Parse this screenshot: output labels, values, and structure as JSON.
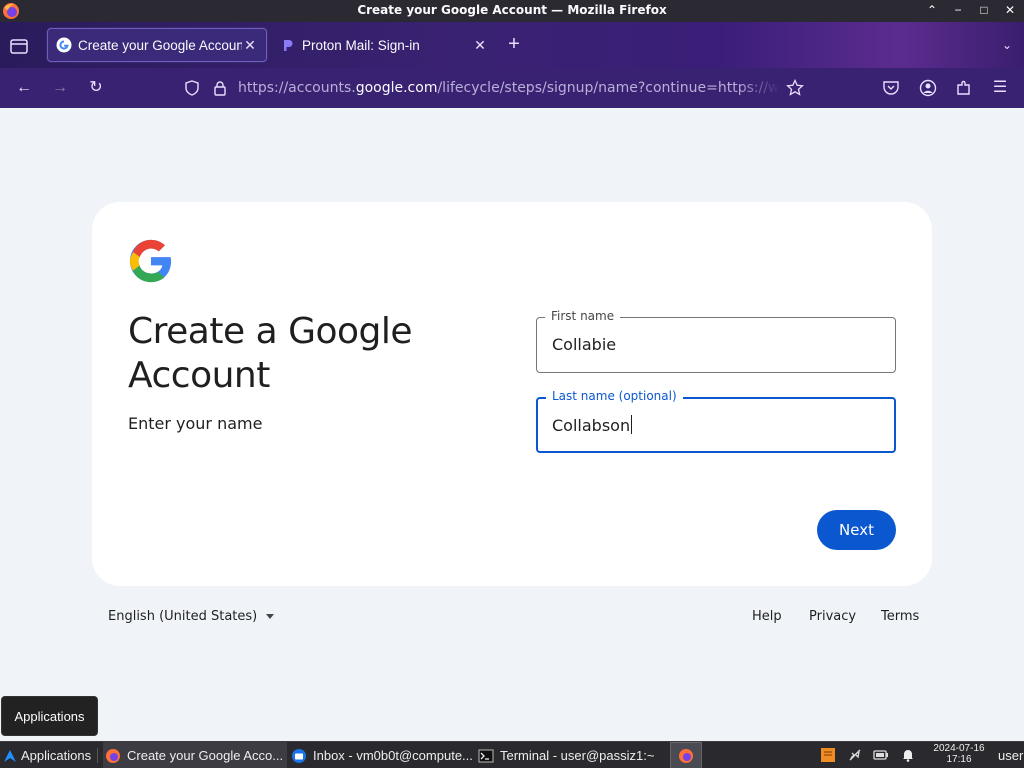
{
  "window": {
    "title": "Create your Google Account — Mozilla Firefox"
  },
  "tabs": [
    {
      "label": "Create your Google Account",
      "active": true,
      "icon": "google-g-icon"
    },
    {
      "label": "Proton Mail: Sign-in",
      "active": false,
      "icon": "proton-icon"
    }
  ],
  "navbar": {
    "url_prefix": "https://accounts.",
    "url_host": "google.com",
    "url_rest": "/lifecycle/steps/signup/name?continue=https://www.youtube.c"
  },
  "page": {
    "heading": "Create a Google Account",
    "subtitle": "Enter your name",
    "first_name": {
      "label": "First name",
      "value": "Collabie"
    },
    "last_name": {
      "label": "Last name (optional)",
      "value": "Collabson"
    },
    "next_label": "Next",
    "footer": {
      "language": "English (United States)",
      "help": "Help",
      "privacy": "Privacy",
      "terms": "Terms"
    }
  },
  "tooltip": "Applications",
  "taskbar": {
    "apps_label": "Applications",
    "items": [
      {
        "label": "Create your Google Acco..."
      },
      {
        "label": "Inbox - vm0b0t@compute..."
      },
      {
        "label": "Terminal - user@passiz1:~"
      }
    ],
    "clock_date": "2024-07-16",
    "clock_time": "17:16",
    "user": "user"
  },
  "colors": {
    "accent": "#0b57d0",
    "page_bg": "#f0f4f9",
    "toolbar": "#3a2272"
  }
}
